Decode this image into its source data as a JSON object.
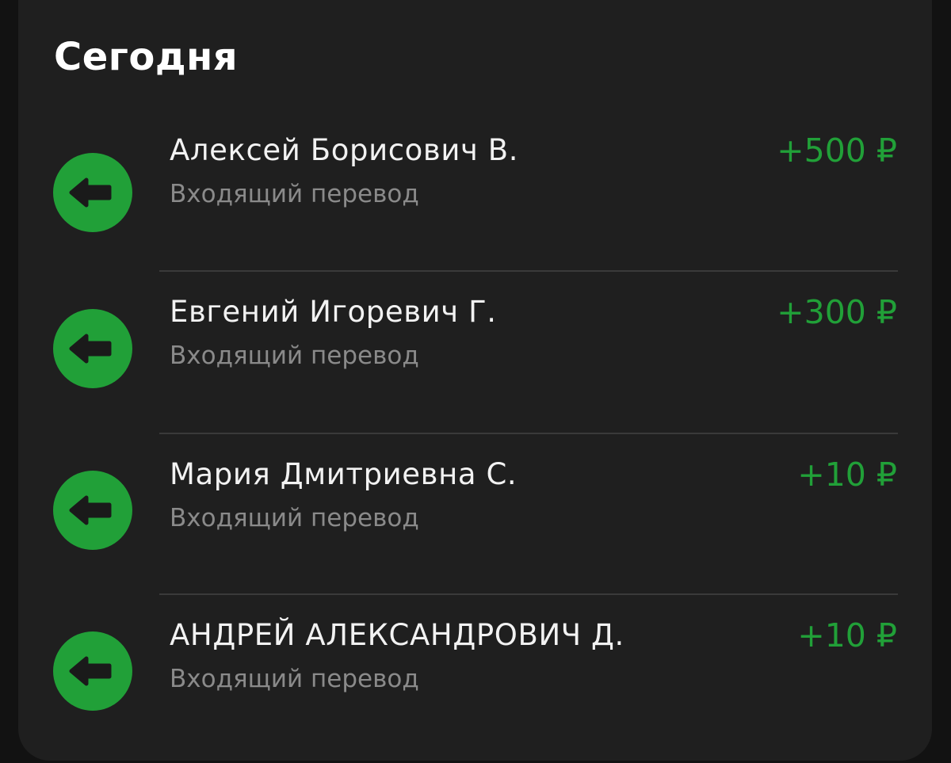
{
  "section": {
    "title": "Сегодня"
  },
  "colors": {
    "accent": "#21a038",
    "background": "#121212",
    "card": "#1f1f1f",
    "primary_text": "#f2f2f2",
    "secondary_text": "#8a8a8a"
  },
  "transactions": [
    {
      "name": "Алексей Борисович В.",
      "type": "Входящий перевод",
      "amount": "+500 ₽",
      "icon": "incoming-arrow-icon"
    },
    {
      "name": "Евгений Игоревич Г.",
      "type": "Входящий перевод",
      "amount": "+300 ₽",
      "icon": "incoming-arrow-icon"
    },
    {
      "name": "Мария Дмитриевна С.",
      "type": "Входящий перевод",
      "amount": "+10 ₽",
      "icon": "incoming-arrow-icon"
    },
    {
      "name": "АНДРЕЙ АЛЕКСАНДРОВИЧ Д.",
      "type": "Входящий перевод",
      "amount": "+10 ₽",
      "icon": "incoming-arrow-icon"
    }
  ]
}
